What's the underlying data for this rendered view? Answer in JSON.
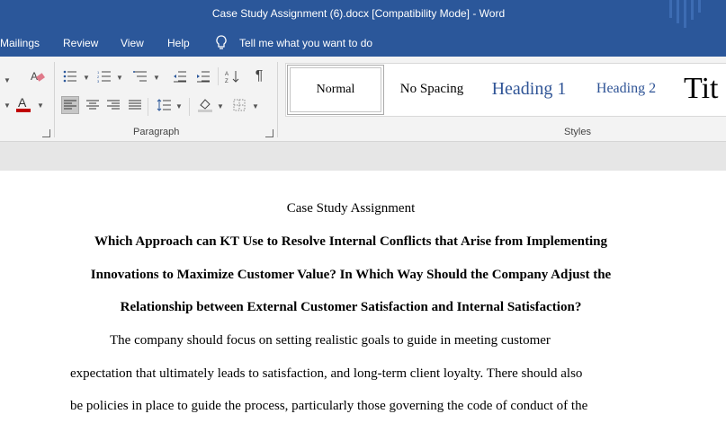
{
  "window": {
    "title": "Case Study Assignment (6).docx [Compatibility Mode]  -  Word"
  },
  "menu": {
    "items": [
      "Mailings",
      "Review",
      "View",
      "Help"
    ],
    "tell_me": "Tell me what you want to do"
  },
  "ribbon": {
    "paragraph_label": "Paragraph",
    "styles_label": "Styles",
    "styles": [
      "Normal",
      "No Spacing",
      "Heading 1",
      "Heading 2",
      "Tit"
    ],
    "selected_style": "Normal",
    "colors": {
      "title_bar": "#2b579a",
      "heading": "#2f5496",
      "font_color_bar": "#c00000"
    }
  },
  "document": {
    "title": "Case Study Assignment",
    "heading_lines": [
      "Which Approach can KT Use to Resolve Internal Conflicts that Arise from Implementing",
      "Innovations to Maximize Customer Value? In Which Way Should the Company Adjust the",
      "Relationship between External Customer Satisfaction and Internal Satisfaction?"
    ],
    "body_lines": [
      "The company should focus on setting realistic goals to guide in meeting customer",
      "expectation that ultimately leads to satisfaction, and long-term client loyalty. There should also",
      "be policies in place to guide the process, particularly those governing the code of conduct of the"
    ]
  }
}
